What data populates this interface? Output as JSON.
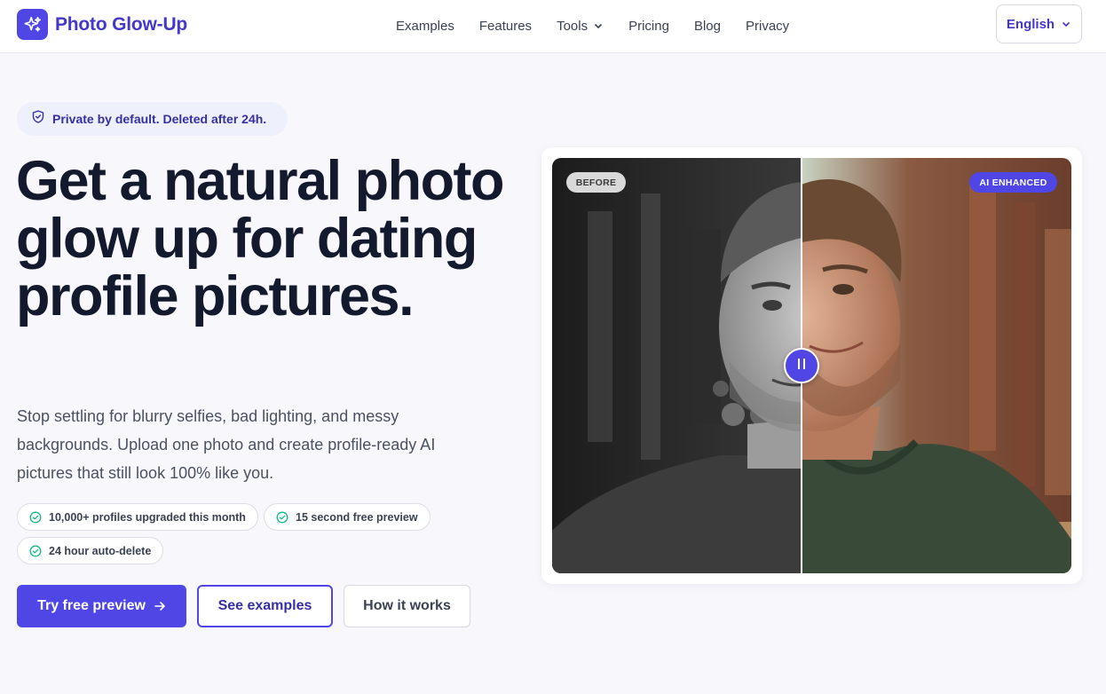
{
  "brand": {
    "name": "Photo Glow-Up",
    "icon": "sparkles-icon",
    "accent": "#4f46e5"
  },
  "nav": {
    "links": [
      "Examples",
      "Features",
      "Tools",
      "Pricing",
      "Blog",
      "Privacy"
    ],
    "language": "English"
  },
  "hero": {
    "privacy_badge": "Private by default. Deleted after 24h.",
    "headline": "Get a natural photo glow up for dating profile pictures.",
    "subtext": "Stop settling for blurry selfies, bad lighting, and messy backgrounds. Upload one photo and create profile-ready AI pictures that still look 100% like you.",
    "chips": [
      "10,000+ profiles upgraded this month",
      "15 second free preview",
      "24 hour auto-delete"
    ],
    "buttons": {
      "primary": "Try free preview",
      "secondary": "See examples",
      "tertiary": "How it works"
    }
  },
  "compare": {
    "before_label": "BEFORE",
    "after_label": "AI ENHANCED"
  }
}
